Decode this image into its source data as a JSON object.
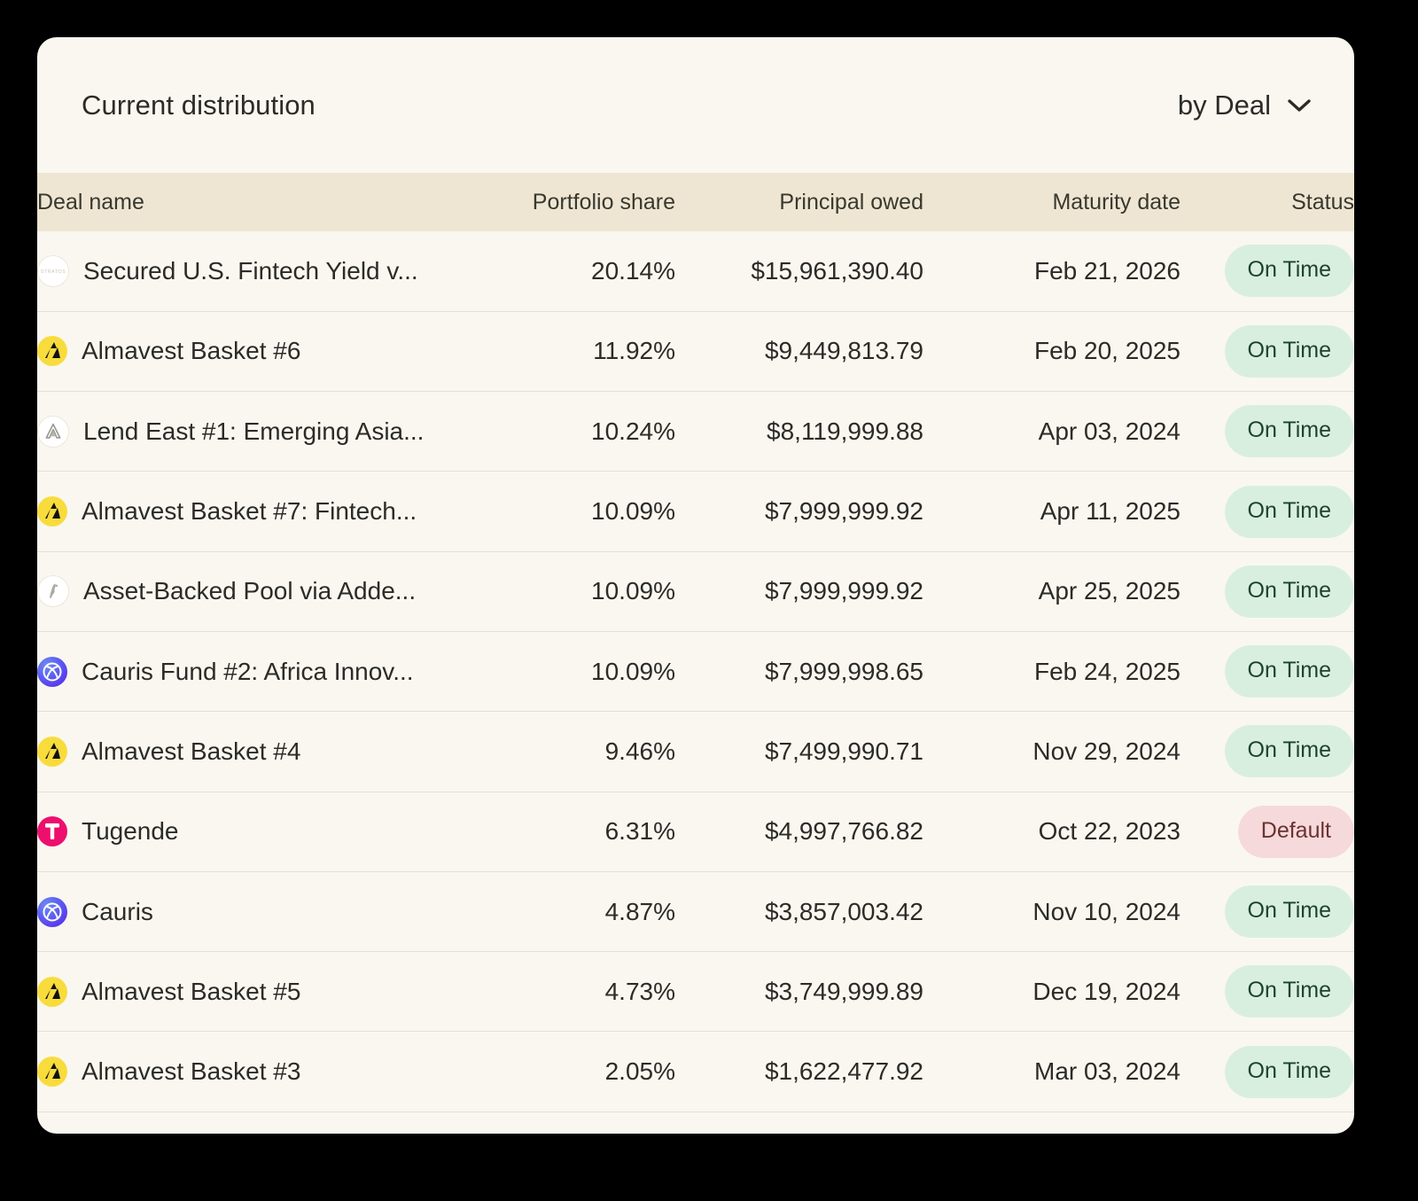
{
  "card": {
    "title": "Current distribution",
    "group_by": {
      "label": "by Deal",
      "icon": "chevron-down-icon"
    }
  },
  "table": {
    "columns": [
      "Deal name",
      "Portfolio share",
      "Principal owed",
      "Maturity date",
      "Status"
    ],
    "rows": [
      {
        "logo": "stratos-logo",
        "name": "Secured U.S. Fintech Yield v...",
        "portfolio_share": "20.14%",
        "principal_owed": "$15,961,390.40",
        "maturity_date": "Feb 21, 2026",
        "status": "On Time",
        "status_kind": "ontime"
      },
      {
        "logo": "almavest-logo",
        "name": "Almavest Basket #6",
        "portfolio_share": "11.92%",
        "principal_owed": "$9,449,813.79",
        "maturity_date": "Feb 20, 2025",
        "status": "On Time",
        "status_kind": "ontime"
      },
      {
        "logo": "lendeast-logo",
        "name": "Lend East #1: Emerging Asia...",
        "portfolio_share": "10.24%",
        "principal_owed": "$8,119,999.88",
        "maturity_date": "Apr 03, 2024",
        "status": "On Time",
        "status_kind": "ontime"
      },
      {
        "logo": "almavest-logo",
        "name": "Almavest Basket #7: Fintech...",
        "portfolio_share": "10.09%",
        "principal_owed": "$7,999,999.92",
        "maturity_date": "Apr 11, 2025",
        "status": "On Time",
        "status_kind": "ontime"
      },
      {
        "logo": "addem-logo",
        "name": "Asset-Backed Pool via Adde...",
        "portfolio_share": "10.09%",
        "principal_owed": "$7,999,999.92",
        "maturity_date": "Apr 25, 2025",
        "status": "On Time",
        "status_kind": "ontime"
      },
      {
        "logo": "cauris-logo",
        "name": "Cauris Fund #2: Africa Innov...",
        "portfolio_share": "10.09%",
        "principal_owed": "$7,999,998.65",
        "maturity_date": "Feb 24, 2025",
        "status": "On Time",
        "status_kind": "ontime"
      },
      {
        "logo": "almavest-logo",
        "name": "Almavest Basket #4",
        "portfolio_share": "9.46%",
        "principal_owed": "$7,499,990.71",
        "maturity_date": "Nov 29, 2024",
        "status": "On Time",
        "status_kind": "ontime"
      },
      {
        "logo": "tugende-logo",
        "name": "Tugende",
        "portfolio_share": "6.31%",
        "principal_owed": "$4,997,766.82",
        "maturity_date": "Oct 22, 2023",
        "status": "Default",
        "status_kind": "default"
      },
      {
        "logo": "cauris-logo",
        "name": "Cauris",
        "portfolio_share": "4.87%",
        "principal_owed": "$3,857,003.42",
        "maturity_date": "Nov 10, 2024",
        "status": "On Time",
        "status_kind": "ontime"
      },
      {
        "logo": "almavest-logo",
        "name": "Almavest Basket #5",
        "portfolio_share": "4.73%",
        "principal_owed": "$3,749,999.89",
        "maturity_date": "Dec 19, 2024",
        "status": "On Time",
        "status_kind": "ontime"
      },
      {
        "logo": "almavest-logo",
        "name": "Almavest Basket #3",
        "portfolio_share": "2.05%",
        "principal_owed": "$1,622,477.92",
        "maturity_date": "Mar 03, 2024",
        "status": "On Time",
        "status_kind": "ontime"
      }
    ]
  },
  "colors": {
    "page_background": "#000000",
    "card_background": "#FAF7F0",
    "table_header_background": "#EEE6D2",
    "row_divider": "#E3DFD4",
    "text_primary": "#2B2B28",
    "pill_ontime_background": "#D8EFE0",
    "pill_ontime_text": "#1E4230",
    "pill_default_background": "#F6D9DA",
    "pill_default_text": "#6A3232",
    "almavest_yellow": "#F8DC3C",
    "tugende_pink": "#EC0F6E",
    "cauris_purple": "#5B5CF0"
  }
}
